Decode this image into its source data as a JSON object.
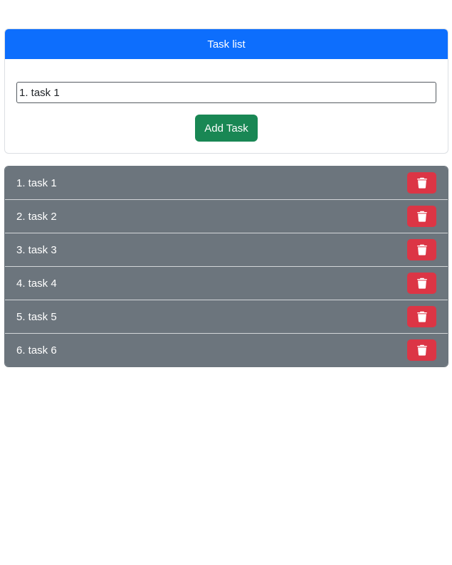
{
  "card": {
    "title": "Task list",
    "input_value": "1. task 1",
    "add_label": "Add Task"
  },
  "tasks": [
    {
      "label": "1. task 1",
      "action_icon": "trash-icon"
    },
    {
      "label": "2. task 2",
      "action_icon": "trash-icon"
    },
    {
      "label": "3. task 3",
      "action_icon": "trash-icon"
    },
    {
      "label": "4. task 4",
      "action_icon": "trash-icon"
    },
    {
      "label": "5. task 5",
      "action_icon": "trash-icon"
    },
    {
      "label": "6. task 6",
      "action_icon": "trash-icon"
    }
  ],
  "colors": {
    "header": "#0d6efd",
    "add_button": "#198754",
    "task_row": "#6c757d",
    "delete_button": "#dc3545"
  }
}
